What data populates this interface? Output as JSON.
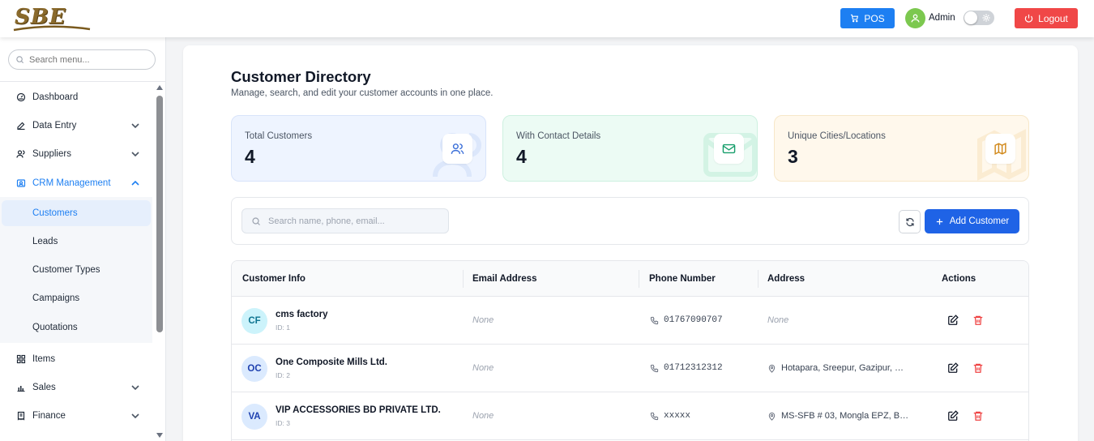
{
  "header": {
    "logo_text": "SBE",
    "pos_label": "POS",
    "user_name": "Admin",
    "logout_label": "Logout"
  },
  "sidebar": {
    "search_placeholder": "Search menu...",
    "items": [
      {
        "label": "Dashboard",
        "icon": "gauge-icon"
      },
      {
        "label": "Data Entry",
        "icon": "edit-icon"
      },
      {
        "label": "Suppliers",
        "icon": "users-icon"
      },
      {
        "label": "CRM Management",
        "icon": "contact-card-icon"
      },
      {
        "label": "Items",
        "icon": "grid-icon"
      },
      {
        "label": "Sales",
        "icon": "bar-chart-icon"
      },
      {
        "label": "Finance",
        "icon": "receipt-icon"
      }
    ],
    "crm_subitems": [
      "Customers",
      "Leads",
      "Customer Types",
      "Campaigns",
      "Quotations"
    ]
  },
  "page": {
    "title": "Customer Directory",
    "subtitle": "Manage, search, and edit your customer accounts in one place."
  },
  "stats": [
    {
      "label": "Total Customers",
      "value": "4",
      "icon": "users-icon",
      "color": "#3b6fd8"
    },
    {
      "label": "With Contact Details",
      "value": "4",
      "icon": "mail-icon",
      "color": "#169e6b"
    },
    {
      "label": "Unique Cities/Locations",
      "value": "3",
      "icon": "map-icon",
      "color": "#d08717"
    }
  ],
  "toolbar": {
    "search_placeholder": "Search name, phone, email...",
    "add_label": "Add Customer"
  },
  "table": {
    "columns": [
      "Customer Info",
      "Email Address",
      "Phone Number",
      "Address",
      "Actions"
    ],
    "rows": [
      {
        "initials": "CF",
        "name": "cms factory",
        "id": "ID: 1",
        "email": "None",
        "phone": "01767090707",
        "address": "None"
      },
      {
        "initials": "OC",
        "name": "One Composite Mills Ltd.",
        "id": "ID: 2",
        "email": "None",
        "phone": "01712312312",
        "address": "Hotapara, Sreepur, Gazipur, …"
      },
      {
        "initials": "VA",
        "name": "VIP ACCESSORIES BD PRIVATE LTD.",
        "id": "ID: 3",
        "email": "None",
        "phone": "xxxxx",
        "address": "MS-SFB # 03, Mongla EPZ, B…"
      }
    ]
  },
  "colors": {
    "primary": "#1d7ff2",
    "add_button": "#1f63e6",
    "logout": "#f04747",
    "avatar": "#7cc84f",
    "delete": "#ef4444"
  }
}
